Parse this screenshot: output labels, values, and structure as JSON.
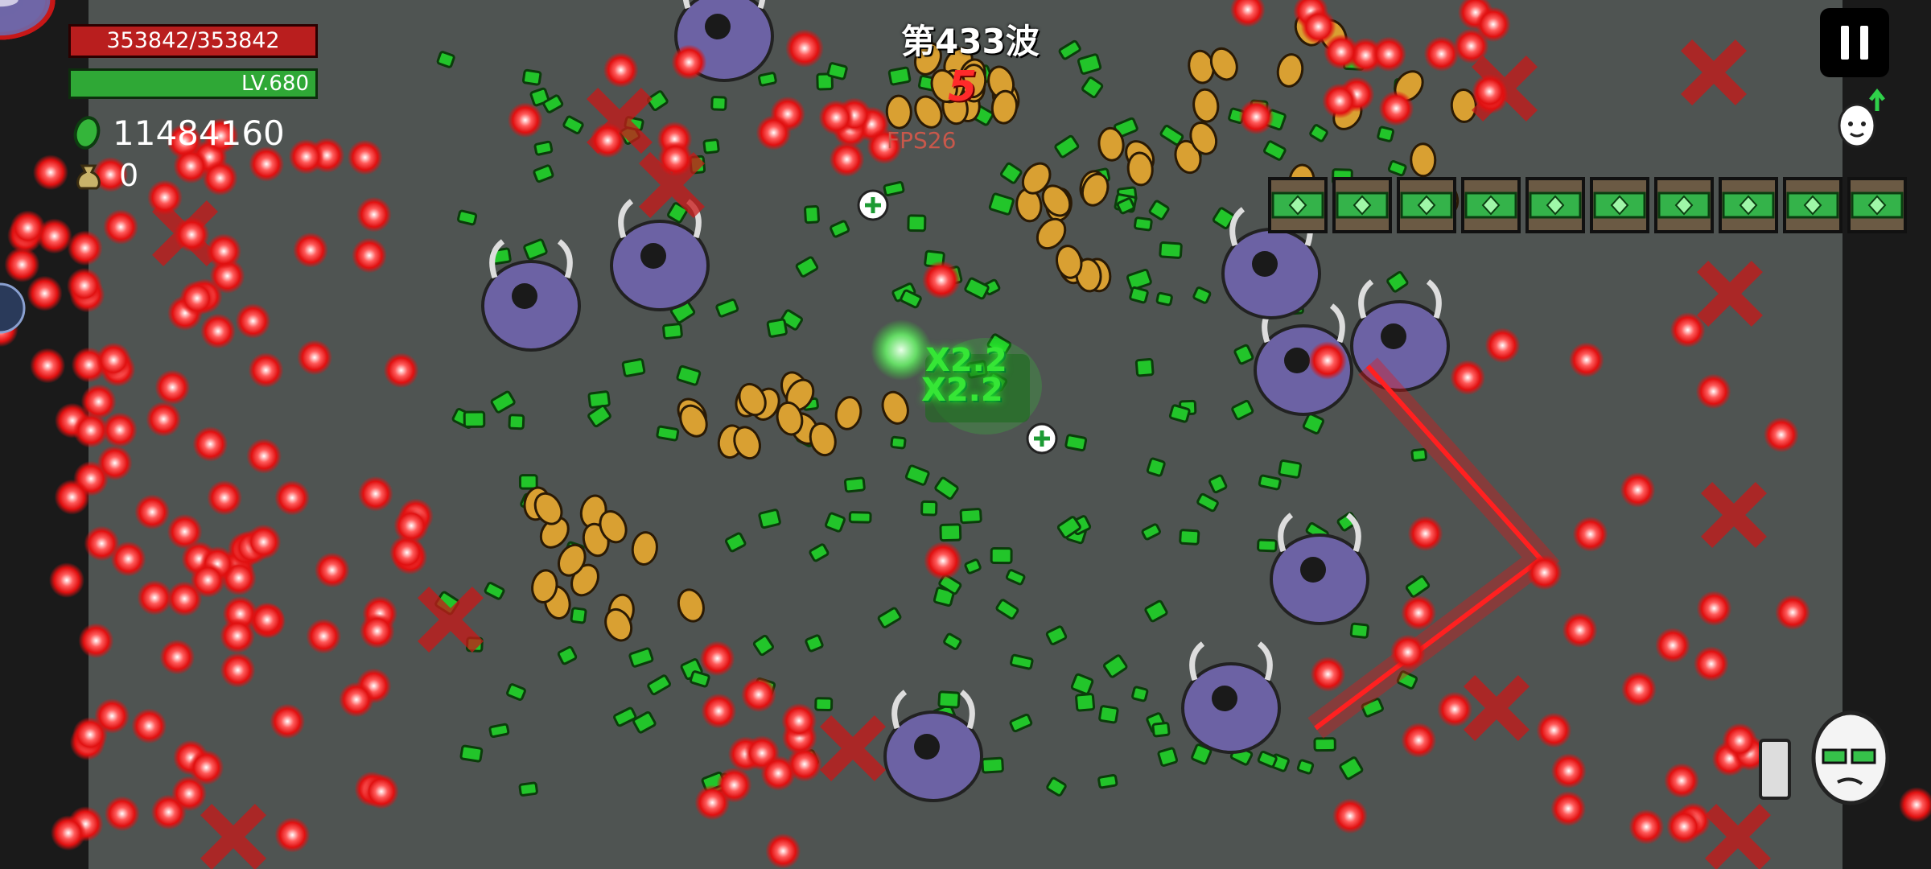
{
  "hud": {
    "hp_text": "353842/353842",
    "hp_fraction": 1.0,
    "level_text": "LV.680",
    "coins": "11484160",
    "bag_count": "0",
    "wave_label": "第433波",
    "countdown": "5",
    "fps_label": "FPS26"
  },
  "combat": {
    "combo_texts": [
      "X2.2",
      "X2.2"
    ]
  },
  "colors": {
    "arena_floor": "#4f5452",
    "border_blood": "#c81818",
    "hp_bar": "#b91e1e",
    "xp_bar": "#2fa836",
    "enemy_purple": "#6f67a8",
    "projectile_red": "#ff2a2a",
    "gem_green": "#22c52a",
    "potato_gold": "#d9a032",
    "crate_green": "#34b34a"
  },
  "icons": {
    "coin": "green-gem-icon",
    "bag": "money-bag-icon",
    "pause": "pause-icon",
    "upgrade": "egg-arrow-icon",
    "portrait": "egg-character-icon"
  }
}
